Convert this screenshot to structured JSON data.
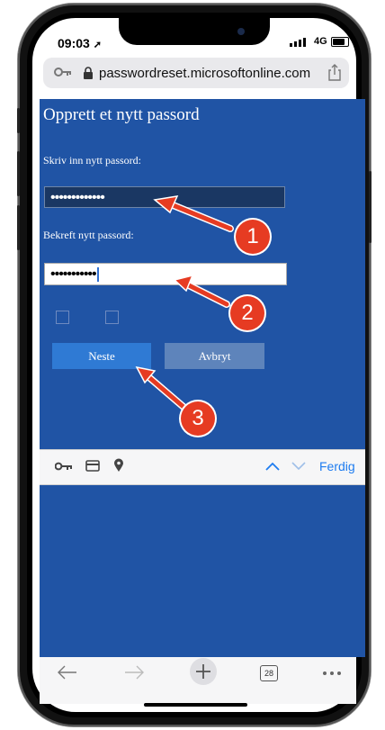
{
  "status_bar": {
    "time": "09:03",
    "network": "4G"
  },
  "address_bar": {
    "url": "passwordreset.microsoftonline.com"
  },
  "page": {
    "title": "Opprett et nytt passord",
    "new_password_label": "Skriv inn nytt passord:",
    "new_password_value": "•••••••••••••",
    "confirm_password_label": "Bekreft nytt passord:",
    "confirm_password_value": "•••••••••••",
    "next_button": "Neste",
    "cancel_button": "Avbryt"
  },
  "keyboard_bar": {
    "done": "Ferdig"
  },
  "toolbar": {
    "tab_count": "28"
  },
  "annotations": {
    "step1": "1",
    "step2": "2",
    "step3": "3"
  },
  "colors": {
    "page_bg": "#2054a5",
    "badge": "#e63b22",
    "link": "#1e7cf0"
  }
}
